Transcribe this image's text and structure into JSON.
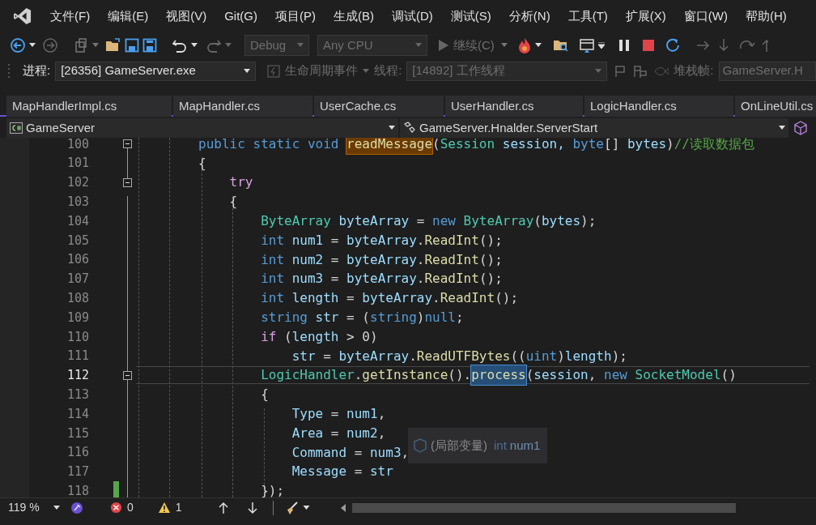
{
  "menu_bar": {
    "items": [
      "文件(F)",
      "编辑(E)",
      "视图(V)",
      "Git(G)",
      "项目(P)",
      "生成(B)",
      "调试(D)",
      "测试(S)",
      "分析(N)",
      "工具(T)",
      "扩展(X)",
      "窗口(W)",
      "帮助(H)"
    ]
  },
  "debug_toolbar": {
    "configuration": {
      "value": "Debug",
      "disabled": true
    },
    "platform": {
      "value": "Any CPU",
      "disabled": true
    },
    "continue_button": {
      "label": "继续(C)",
      "disabled": true
    }
  },
  "process_toolbar": {
    "process_label": "进程:",
    "process": {
      "value": "[26356] GameServer.exe",
      "disabled": false
    },
    "lifecycle_events": {
      "label": "生命周期事件",
      "disabled": true
    },
    "thread_label": "线程:",
    "thread": {
      "value": "[14892] 工作线程",
      "disabled": true
    },
    "stack_frame_label": "堆栈帧:",
    "stack_frame": {
      "value": "GameServer.H",
      "disabled": true
    }
  },
  "tabs": [
    {
      "label": "MapHandlerImpl.cs",
      "selected": false
    },
    {
      "label": "MapHandler.cs",
      "selected": false
    },
    {
      "label": "UserCache.cs",
      "selected": false
    },
    {
      "label": "UserHandler.cs",
      "selected": false
    },
    {
      "label": "LogicHandler.cs",
      "selected": false
    },
    {
      "label": "OnLineUtil.cs",
      "selected": false
    }
  ],
  "navigation_bar": {
    "project": "GameServer",
    "member": "GameServer.Hnalder.ServerStart"
  },
  "editor": {
    "lines": [
      {
        "number": "100",
        "foldable": true,
        "current": false,
        "changed": false,
        "tokens": [
          {
            "kind": "keyword",
            "text": "        public static void "
          },
          {
            "kind": "method",
            "text": "readMessage",
            "highlighted": true
          },
          {
            "kind": "punct",
            "text": "("
          },
          {
            "kind": "type",
            "text": "Session"
          },
          {
            "kind": "ident",
            "text": " session, "
          },
          {
            "kind": "keyword",
            "text": "byte"
          },
          {
            "kind": "punct",
            "text": "[] "
          },
          {
            "kind": "ident",
            "text": "bytes"
          },
          {
            "kind": "punct",
            "text": ")"
          },
          {
            "kind": "comment",
            "text": "//读取数据包"
          }
        ]
      },
      {
        "number": "101",
        "foldable": false,
        "current": false,
        "changed": false,
        "tokens": [
          {
            "kind": "punct",
            "text": "        {"
          }
        ]
      },
      {
        "number": "102",
        "foldable": true,
        "current": false,
        "changed": false,
        "tokens": [
          {
            "kind": "control",
            "text": "            try"
          }
        ]
      },
      {
        "number": "103",
        "foldable": false,
        "current": false,
        "changed": false,
        "tokens": [
          {
            "kind": "punct",
            "text": "            {"
          }
        ]
      },
      {
        "number": "104",
        "foldable": false,
        "current": false,
        "changed": false,
        "tokens": [
          {
            "kind": "type",
            "text": "                ByteArray"
          },
          {
            "kind": "ident",
            "text": " byteArray "
          },
          {
            "kind": "punct",
            "text": "= "
          },
          {
            "kind": "keyword",
            "text": "new "
          },
          {
            "kind": "type",
            "text": "ByteArray"
          },
          {
            "kind": "punct",
            "text": "("
          },
          {
            "kind": "ident",
            "text": "bytes"
          },
          {
            "kind": "punct",
            "text": ");"
          }
        ]
      },
      {
        "number": "105",
        "foldable": false,
        "current": false,
        "changed": false,
        "tokens": [
          {
            "kind": "keyword",
            "text": "                int"
          },
          {
            "kind": "ident",
            "text": " num1 "
          },
          {
            "kind": "punct",
            "text": "= "
          },
          {
            "kind": "ident",
            "text": "byteArray"
          },
          {
            "kind": "punct",
            "text": "."
          },
          {
            "kind": "method",
            "text": "ReadInt"
          },
          {
            "kind": "punct",
            "text": "();"
          }
        ]
      },
      {
        "number": "106",
        "foldable": false,
        "current": false,
        "changed": false,
        "tokens": [
          {
            "kind": "keyword",
            "text": "                int"
          },
          {
            "kind": "ident",
            "text": " num2 "
          },
          {
            "kind": "punct",
            "text": "= "
          },
          {
            "kind": "ident",
            "text": "byteArray"
          },
          {
            "kind": "punct",
            "text": "."
          },
          {
            "kind": "method",
            "text": "ReadInt"
          },
          {
            "kind": "punct",
            "text": "();"
          }
        ]
      },
      {
        "number": "107",
        "foldable": false,
        "current": false,
        "changed": false,
        "tokens": [
          {
            "kind": "keyword",
            "text": "                int"
          },
          {
            "kind": "ident",
            "text": " num3 "
          },
          {
            "kind": "punct",
            "text": "= "
          },
          {
            "kind": "ident",
            "text": "byteArray"
          },
          {
            "kind": "punct",
            "text": "."
          },
          {
            "kind": "method",
            "text": "ReadInt"
          },
          {
            "kind": "punct",
            "text": "();"
          }
        ]
      },
      {
        "number": "108",
        "foldable": false,
        "current": false,
        "changed": false,
        "tokens": [
          {
            "kind": "keyword",
            "text": "                int"
          },
          {
            "kind": "ident",
            "text": " length "
          },
          {
            "kind": "punct",
            "text": "= "
          },
          {
            "kind": "ident",
            "text": "byteArray"
          },
          {
            "kind": "punct",
            "text": "."
          },
          {
            "kind": "method",
            "text": "ReadInt"
          },
          {
            "kind": "punct",
            "text": "();"
          }
        ]
      },
      {
        "number": "109",
        "foldable": false,
        "current": false,
        "changed": false,
        "tokens": [
          {
            "kind": "keyword",
            "text": "                string"
          },
          {
            "kind": "ident",
            "text": " str "
          },
          {
            "kind": "punct",
            "text": "= ("
          },
          {
            "kind": "keyword",
            "text": "string"
          },
          {
            "kind": "punct",
            "text": ")"
          },
          {
            "kind": "keyword",
            "text": "null"
          },
          {
            "kind": "punct",
            "text": ";"
          }
        ]
      },
      {
        "number": "110",
        "foldable": false,
        "current": false,
        "changed": false,
        "tokens": [
          {
            "kind": "control",
            "text": "                if"
          },
          {
            "kind": "punct",
            "text": " ("
          },
          {
            "kind": "ident",
            "text": "length"
          },
          {
            "kind": "punct",
            "text": " > 0)"
          }
        ]
      },
      {
        "number": "111",
        "foldable": false,
        "current": false,
        "changed": false,
        "tokens": [
          {
            "kind": "ident",
            "text": "                    str "
          },
          {
            "kind": "punct",
            "text": "= "
          },
          {
            "kind": "ident",
            "text": "byteArray"
          },
          {
            "kind": "punct",
            "text": "."
          },
          {
            "kind": "method",
            "text": "ReadUTFBytes"
          },
          {
            "kind": "punct",
            "text": "(("
          },
          {
            "kind": "keyword",
            "text": "uint"
          },
          {
            "kind": "punct",
            "text": ")"
          },
          {
            "kind": "ident",
            "text": "length"
          },
          {
            "kind": "punct",
            "text": ");"
          }
        ]
      },
      {
        "number": "112",
        "foldable": true,
        "current": true,
        "changed": false,
        "tokens": [
          {
            "kind": "type",
            "text": "                LogicHandler"
          },
          {
            "kind": "punct",
            "text": "."
          },
          {
            "kind": "method",
            "text": "getInstance"
          },
          {
            "kind": "punct",
            "text": "()."
          },
          {
            "kind": "method",
            "text": "process",
            "selected": true
          },
          {
            "kind": "punct",
            "text": "("
          },
          {
            "kind": "ident",
            "text": "session"
          },
          {
            "kind": "punct",
            "text": ", "
          },
          {
            "kind": "keyword",
            "text": "new "
          },
          {
            "kind": "type",
            "text": "SocketModel"
          },
          {
            "kind": "punct",
            "text": "()"
          }
        ]
      },
      {
        "number": "113",
        "foldable": false,
        "current": false,
        "changed": false,
        "tokens": [
          {
            "kind": "punct",
            "text": "                {"
          }
        ]
      },
      {
        "number": "114",
        "foldable": false,
        "current": false,
        "changed": false,
        "tokens": [
          {
            "kind": "ident",
            "text": "                    Type "
          },
          {
            "kind": "punct",
            "text": "= "
          },
          {
            "kind": "ident",
            "text": "num1"
          },
          {
            "kind": "punct",
            "text": ","
          }
        ]
      },
      {
        "number": "115",
        "foldable": false,
        "current": false,
        "changed": false,
        "tokens": [
          {
            "kind": "ident",
            "text": "                    Area "
          },
          {
            "kind": "punct",
            "text": "= "
          },
          {
            "kind": "ident",
            "text": "num2"
          },
          {
            "kind": "punct",
            "text": ","
          }
        ]
      },
      {
        "number": "116",
        "foldable": false,
        "current": false,
        "changed": false,
        "tokens": [
          {
            "kind": "ident",
            "text": "                    Command "
          },
          {
            "kind": "punct",
            "text": "= "
          },
          {
            "kind": "ident",
            "text": "num3"
          },
          {
            "kind": "punct",
            "text": ","
          }
        ]
      },
      {
        "number": "117",
        "foldable": false,
        "current": false,
        "changed": false,
        "tokens": [
          {
            "kind": "ident",
            "text": "                    Message "
          },
          {
            "kind": "punct",
            "text": "= "
          },
          {
            "kind": "ident",
            "text": "str"
          }
        ]
      },
      {
        "number": "118",
        "foldable": false,
        "current": false,
        "changed": true,
        "tokens": [
          {
            "kind": "punct",
            "text": "                });"
          }
        ]
      }
    ],
    "quick_info": {
      "prefix": "(局部变量)",
      "keyword": "int",
      "name": "num1"
    }
  },
  "status_bar": {
    "zoom": "119 %",
    "errors": "0",
    "warnings": "1"
  }
}
